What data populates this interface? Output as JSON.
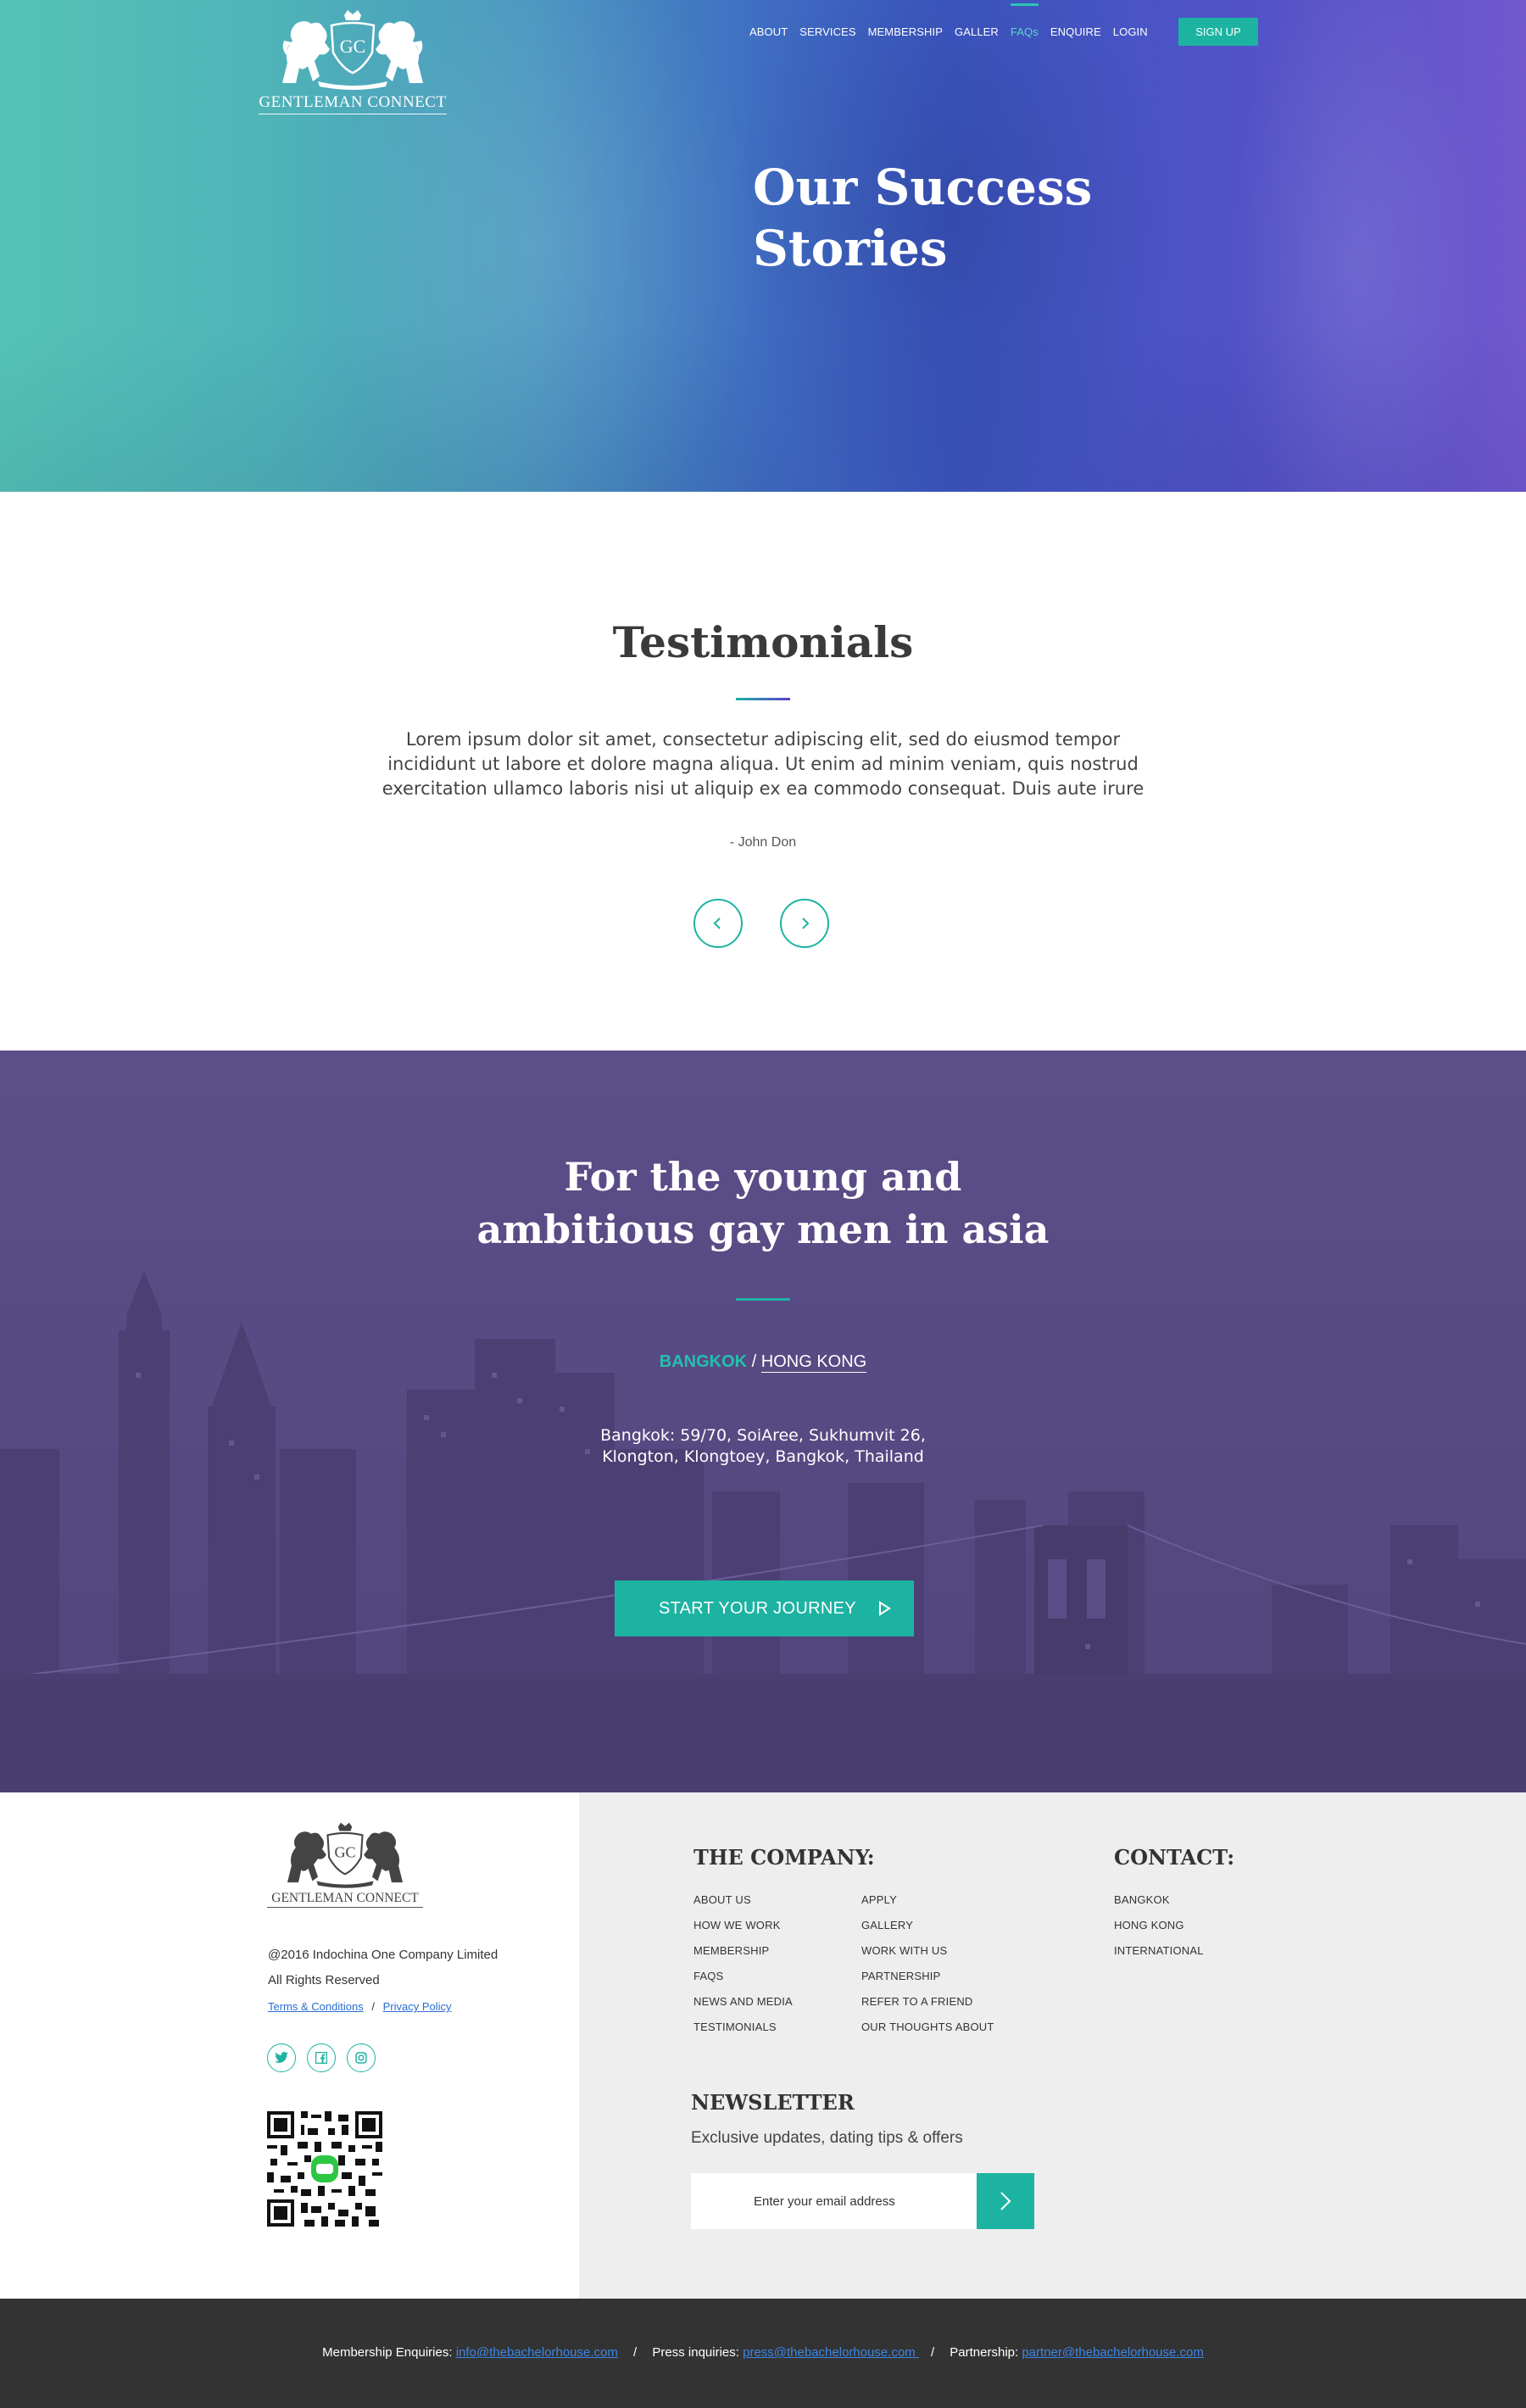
{
  "brand": {
    "logo_monogram": "GC",
    "name": "GENTLEMAN CONNECT"
  },
  "nav": {
    "items": [
      {
        "label": "ABOUT",
        "active": false
      },
      {
        "label": "SERVICES",
        "active": false
      },
      {
        "label": "MEMBERSHIP",
        "active": false
      },
      {
        "label": "GALLER",
        "active": false
      },
      {
        "label": "FAQs",
        "active": true
      },
      {
        "label": "ENQUIRE",
        "active": false
      },
      {
        "label": "LOGIN",
        "active": false
      }
    ],
    "signup": "SIGN UP"
  },
  "hero": {
    "title_line1": "Our Success",
    "title_line2": "Stories"
  },
  "testimonials": {
    "title": "Testimonials",
    "body": "Lorem ipsum dolor sit amet, consectetur adipiscing elit, sed do eiusmod tempor incididunt ut labore et dolore magna aliqua. Ut enim ad minim veniam, quis nostrud exercitation ullamco laboris nisi ut aliquip ex ea commodo consequat. Duis aute irure",
    "author": "- John Don",
    "prev_icon": "chevron-left-icon",
    "next_icon": "chevron-right-icon"
  },
  "cta": {
    "title_line1": "For the young and",
    "title_line2": "ambitious gay men in asia",
    "city_active": "BANGKOK",
    "separator": "/",
    "city_other": "HONG KONG",
    "address_line1": "Bangkok: 59/70, SoiAree, Sukhumvit 26,",
    "address_line2": "Klongton, Klongtoey, Bangkok, Thailand",
    "button": "START YOUR JOURNEY",
    "button_icon": "play-icon"
  },
  "footer": {
    "copyright": "@2016 Indochina One Company Limited",
    "rights": "All Rights Reserved",
    "terms": "Terms & Conditions",
    "legal_sep": "/",
    "privacy": "Privacy Policy",
    "socials": [
      "twitter-icon",
      "facebook-icon",
      "instagram-icon"
    ],
    "company": {
      "heading": "THE COMPANY:",
      "col1": [
        "ABOUT US",
        "HOW WE WORK",
        "MEMBERSHIP",
        "FAQS",
        "NEWS AND MEDIA",
        "TESTIMONIALS"
      ],
      "col2": [
        "APPLY",
        "GALLERY",
        "WORK WITH US",
        "PARTNERSHIP",
        "REFER TO A FRIEND",
        "OUR THOUGHTS ABOUT"
      ]
    },
    "contact": {
      "heading": "CONTACT:",
      "items": [
        "BANGKOK",
        "HONG KONG",
        "INTERNATIONAL"
      ]
    },
    "newsletter": {
      "heading": "NEWSLETTER",
      "subtitle": "Exclusive updates, dating tips & offers",
      "placeholder": "Enter your email address"
    }
  },
  "bottom_bar": {
    "membership_label": "Membership Enquiries:",
    "membership_email": "info@thebachelorhouse.com",
    "press_label": "Press inquiries:",
    "press_email": "press@thebachelorhouse.com ",
    "partnership_label": "Partnership:",
    "partnership_email": "partner@thebachelorhouse.com ",
    "sep": "/"
  },
  "colors": {
    "accent": "#1db3a2",
    "purple": "#5a4c86",
    "footer_dark": "#333333",
    "link": "#3d86e6"
  }
}
